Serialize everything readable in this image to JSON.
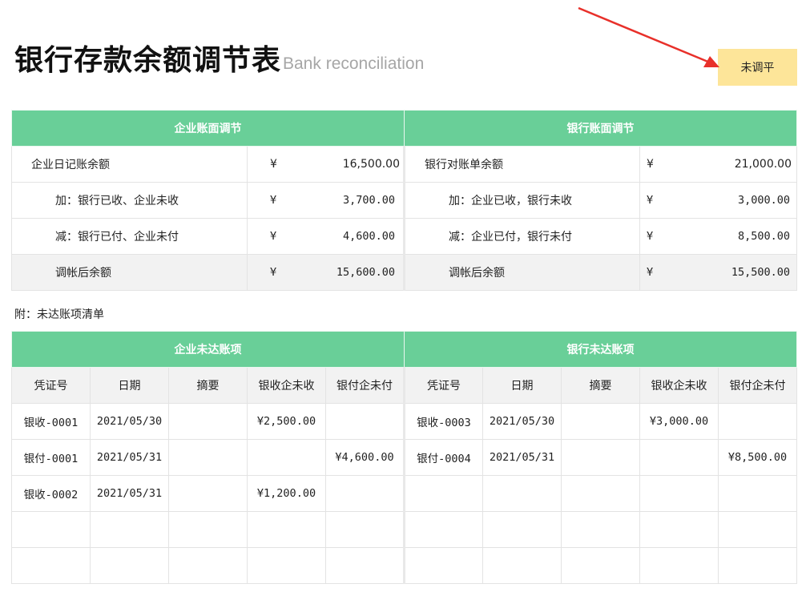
{
  "header": {
    "title": "银行存款余额调节表",
    "subtitle": "Bank reconciliation",
    "status": "未调平"
  },
  "recon": {
    "company_header": "企业账面调节",
    "bank_header": "银行账面调节",
    "currency": "¥",
    "company_rows": [
      {
        "label": "企业日记账余额",
        "value": "16,500.00"
      },
      {
        "label": "加：银行已收、企业未收",
        "value": "3,700.00"
      },
      {
        "label": "减：银行已付、企业未付",
        "value": "4,600.00"
      },
      {
        "label": "调帐后余额",
        "value": "15,600.00"
      }
    ],
    "bank_rows": [
      {
        "label": "银行对账单余额",
        "value": "21,000.00"
      },
      {
        "label": "加：企业已收，银行未收",
        "value": "3,000.00"
      },
      {
        "label": "减：企业已付，银行未付",
        "value": "8,500.00"
      },
      {
        "label": "调帐后余额",
        "value": "15,500.00"
      }
    ]
  },
  "note": "附：未达账项清单",
  "outstanding": {
    "company_header": "企业未达账项",
    "bank_header": "银行未达账项",
    "columns": [
      "凭证号",
      "日期",
      "摘要",
      "银收企未收",
      "银付企未付"
    ],
    "rows": [
      {
        "left": [
          "银收-0001",
          "2021/05/30",
          "",
          "¥2,500.00",
          ""
        ],
        "right": [
          "银收-0003",
          "2021/05/30",
          "",
          "¥3,000.00",
          ""
        ]
      },
      {
        "left": [
          "银付-0001",
          "2021/05/31",
          "",
          "",
          "¥4,600.00"
        ],
        "right": [
          "银付-0004",
          "2021/05/31",
          "",
          "",
          "¥8,500.00"
        ]
      },
      {
        "left": [
          "银收-0002",
          "2021/05/31",
          "",
          "¥1,200.00",
          ""
        ],
        "right": [
          "",
          "",
          "",
          "",
          ""
        ]
      },
      {
        "left": [
          "",
          "",
          "",
          "",
          ""
        ],
        "right": [
          "",
          "",
          "",
          "",
          ""
        ]
      },
      {
        "left": [
          "",
          "",
          "",
          "",
          ""
        ],
        "right": [
          "",
          "",
          "",
          "",
          ""
        ]
      }
    ]
  },
  "colors": {
    "header_green": "#69cf98",
    "status_yellow": "#fde599",
    "arrow_red": "#e8302a",
    "subtotal_grey": "#f2f2f2"
  },
  "icons": {
    "arrow": "annotation-arrow-icon"
  }
}
